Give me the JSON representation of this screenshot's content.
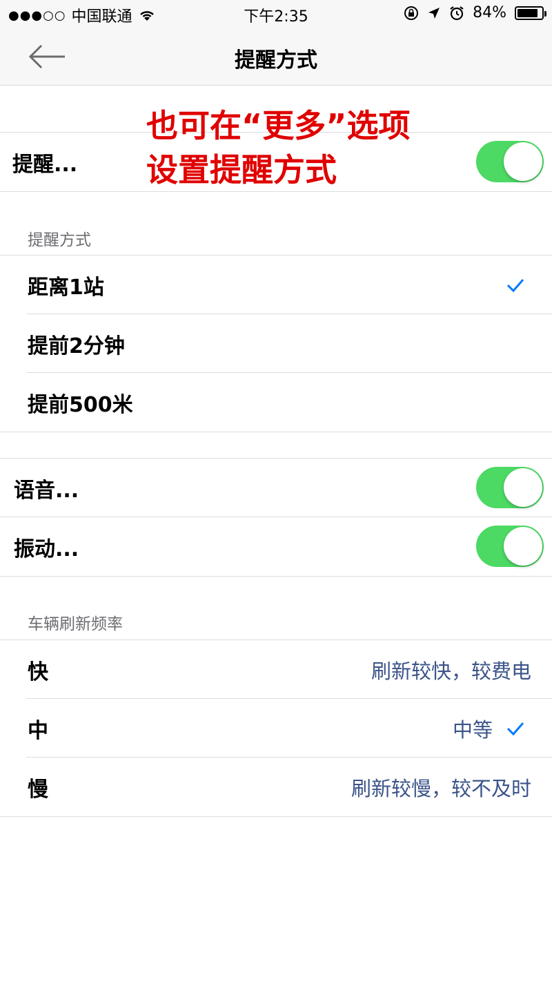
{
  "status_bar": {
    "signal": "●●●○○",
    "carrier": "中国联通",
    "time": "下午2:35",
    "battery_percent": "84%",
    "battery_level": 0.84
  },
  "nav": {
    "title": "提醒方式"
  },
  "reminder_toggle": {
    "label": "提醒...",
    "on": true
  },
  "annotation": {
    "line1": "也可在“更多”选项",
    "line2": "设置提醒方式"
  },
  "reminder_mode": {
    "header": "提醒方式",
    "options": [
      {
        "label": "距离1站",
        "selected": true
      },
      {
        "label": "提前2分钟",
        "selected": false
      },
      {
        "label": "提前500米",
        "selected": false
      }
    ]
  },
  "alerts": {
    "voice": {
      "label": "语音...",
      "on": true
    },
    "vibrate": {
      "label": "振动...",
      "on": true
    }
  },
  "refresh": {
    "header": "车辆刷新频率",
    "options": [
      {
        "label": "快",
        "detail": "刷新较快，较费电",
        "selected": false
      },
      {
        "label": "中",
        "detail": "中等",
        "selected": true
      },
      {
        "label": "慢",
        "detail": "刷新较慢，较不及时",
        "selected": false
      }
    ]
  },
  "colors": {
    "toggle_on": "#4cd964",
    "check": "#007aff",
    "detail_text": "#3b5488",
    "annotation": "#e00000"
  }
}
